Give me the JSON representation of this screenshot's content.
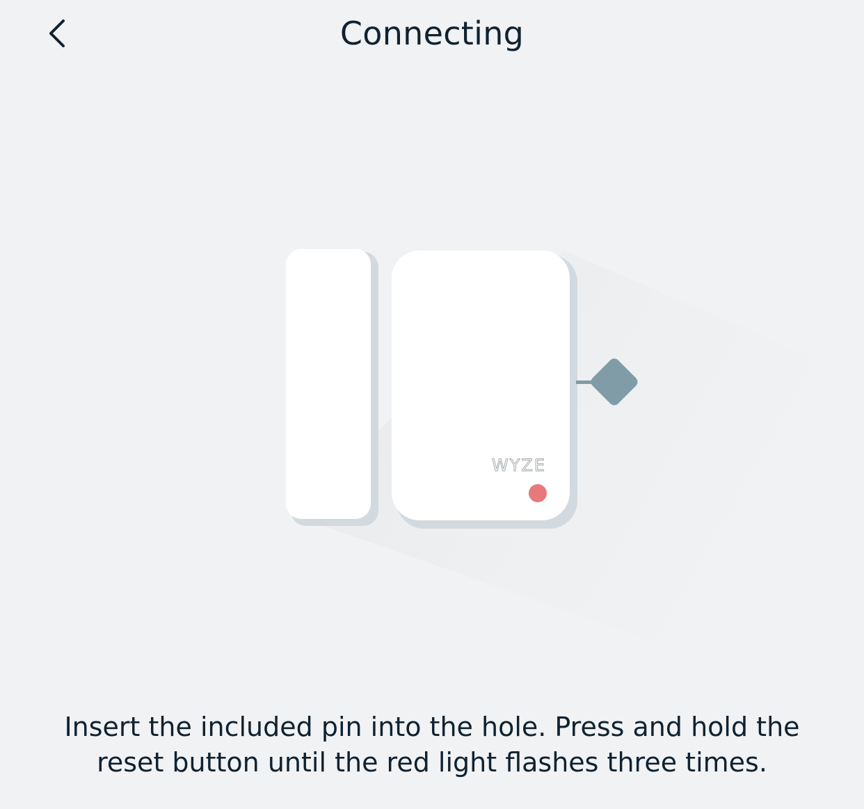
{
  "header": {
    "title": "Connecting",
    "back_icon": "chevron-left-icon"
  },
  "illustration": {
    "device_brand": "WYZE",
    "led_color": "#e8787a",
    "pin_color": "#7f9ca7"
  },
  "instruction": {
    "text": "Insert the included pin into the hole. Press and hold the reset button until the red light flashes three times."
  }
}
